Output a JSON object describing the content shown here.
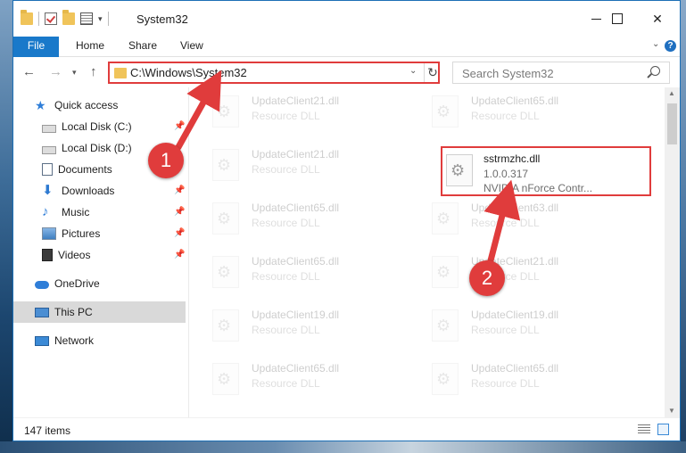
{
  "window": {
    "title": "System32",
    "accent": "#1979ca",
    "highlight_color": "#e03c3c"
  },
  "ribbon": {
    "tabs": [
      "File",
      "Home",
      "Share",
      "View"
    ]
  },
  "address": {
    "path": "C:\\Windows\\System32",
    "search_placeholder": "Search System32"
  },
  "sidebar": {
    "items": [
      {
        "label": "Quick access",
        "icon": "star-icon",
        "pinned": false
      },
      {
        "label": "Local Disk (C:)",
        "icon": "disk-icon",
        "pinned": true
      },
      {
        "label": "Local Disk (D:)",
        "icon": "disk-icon",
        "pinned": false
      },
      {
        "label": "Documents",
        "icon": "documents-icon",
        "pinned": false
      },
      {
        "label": "Downloads",
        "icon": "download-icon",
        "pinned": true
      },
      {
        "label": "Music",
        "icon": "music-icon",
        "pinned": true
      },
      {
        "label": "Pictures",
        "icon": "pictures-icon",
        "pinned": true
      },
      {
        "label": "Videos",
        "icon": "videos-icon",
        "pinned": true
      },
      {
        "label": "OneDrive",
        "icon": "onedrive-icon",
        "pinned": false
      },
      {
        "label": "This PC",
        "icon": "this-pc-icon",
        "pinned": false,
        "selected": true
      },
      {
        "label": "Network",
        "icon": "network-icon",
        "pinned": false
      }
    ]
  },
  "files": {
    "left_column": [
      {
        "name": "UpdateClient21.dll",
        "type": "Resource DLL"
      },
      {
        "name": "UpdateClient21.dll",
        "type": "Resource DLL"
      },
      {
        "name": "UpdateClient65.dll",
        "type": "Resource DLL"
      },
      {
        "name": "UpdateClient65.dll",
        "type": "Resource DLL"
      },
      {
        "name": "UpdateClient19.dll",
        "type": "Resource DLL"
      },
      {
        "name": "UpdateClient65.dll",
        "type": "Resource DLL"
      }
    ],
    "right_column": [
      {
        "name": "UpdateClient65.dll",
        "type": "Resource DLL"
      },
      {
        "name": "UpdateClient63.dll",
        "type": "Resource DLL"
      },
      {
        "name": "UpdateClient21.dll",
        "type": "Resource DLL"
      },
      {
        "name": "UpdateClient19.dll",
        "type": "Resource DLL"
      },
      {
        "name": "UpdateClient65.dll",
        "type": "Resource DLL"
      }
    ],
    "highlighted": {
      "name": "sstrmzhc.dll",
      "version": "1.0.0.317",
      "description": "NVIDIA nForce Contr..."
    }
  },
  "status": {
    "item_count": "147 items"
  },
  "callouts": {
    "step1": "1",
    "step2": "2"
  }
}
